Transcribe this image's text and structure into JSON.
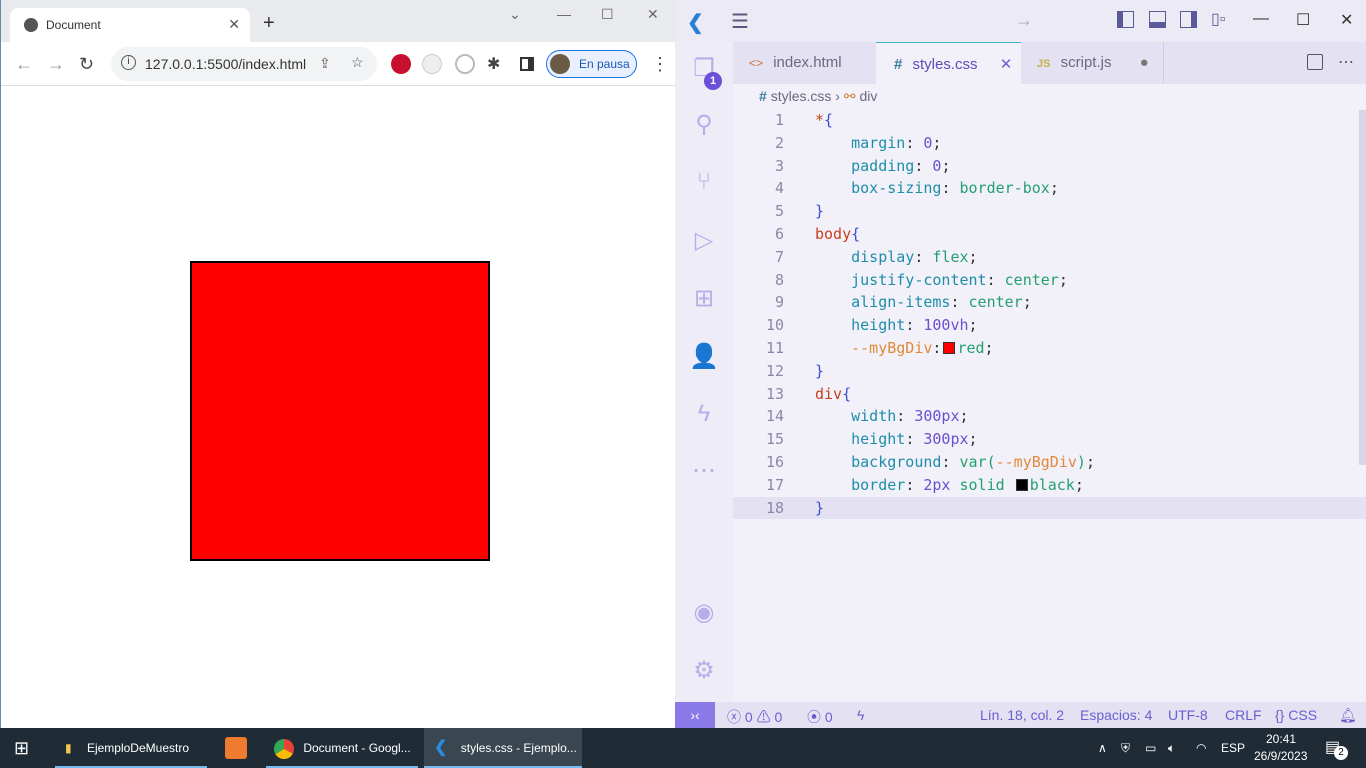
{
  "browser": {
    "tab_title": "Document",
    "url": "127.0.0.1:5500/index.html",
    "profile_label": "En pausa",
    "box_color": "#ff0000"
  },
  "vscode": {
    "tabs": [
      {
        "label": "index.html",
        "icon": "<>"
      },
      {
        "label": "styles.css",
        "icon": "#"
      },
      {
        "label": "script.js",
        "icon": "JS"
      }
    ],
    "explorer_badge": "1",
    "breadcrumb": {
      "file": "styles.css",
      "symbol": "div"
    },
    "lines": [
      [
        [
          "sel",
          "*"
        ],
        [
          "br",
          "{"
        ]
      ],
      [
        [
          "pn",
          "    "
        ],
        [
          "prop",
          "margin"
        ],
        [
          "pn",
          ": "
        ],
        [
          "numv",
          "0"
        ],
        [
          "pn",
          ";"
        ]
      ],
      [
        [
          "pn",
          "    "
        ],
        [
          "prop",
          "padding"
        ],
        [
          "pn",
          ": "
        ],
        [
          "numv",
          "0"
        ],
        [
          "pn",
          ";"
        ]
      ],
      [
        [
          "pn",
          "    "
        ],
        [
          "prop",
          "box-sizing"
        ],
        [
          "pn",
          ": "
        ],
        [
          "val",
          "border-box"
        ],
        [
          "pn",
          ";"
        ]
      ],
      [
        [
          "br",
          "}"
        ]
      ],
      [
        [
          "sel",
          "body"
        ],
        [
          "br",
          "{"
        ]
      ],
      [
        [
          "pn",
          "    "
        ],
        [
          "prop",
          "display"
        ],
        [
          "pn",
          ": "
        ],
        [
          "val",
          "flex"
        ],
        [
          "pn",
          ";"
        ]
      ],
      [
        [
          "pn",
          "    "
        ],
        [
          "prop",
          "justify-content"
        ],
        [
          "pn",
          ": "
        ],
        [
          "val",
          "center"
        ],
        [
          "pn",
          ";"
        ]
      ],
      [
        [
          "pn",
          "    "
        ],
        [
          "prop",
          "align-items"
        ],
        [
          "pn",
          ": "
        ],
        [
          "val",
          "center"
        ],
        [
          "pn",
          ";"
        ]
      ],
      [
        [
          "pn",
          "    "
        ],
        [
          "prop",
          "height"
        ],
        [
          "pn",
          ": "
        ],
        [
          "numv",
          "100vh"
        ],
        [
          "pn",
          ";"
        ]
      ],
      [
        [
          "pn",
          "    "
        ],
        [
          "var",
          "--myBgDiv"
        ],
        [
          "pn",
          ":"
        ],
        [
          "swatch",
          "#ff0000"
        ],
        [
          "val",
          "red"
        ],
        [
          "pn",
          ";"
        ]
      ],
      [
        [
          "br",
          "}"
        ]
      ],
      [
        [
          "sel",
          "div"
        ],
        [
          "br",
          "{"
        ]
      ],
      [
        [
          "pn",
          "    "
        ],
        [
          "prop",
          "width"
        ],
        [
          "pn",
          ": "
        ],
        [
          "numv",
          "300px"
        ],
        [
          "pn",
          ";"
        ]
      ],
      [
        [
          "pn",
          "    "
        ],
        [
          "prop",
          "height"
        ],
        [
          "pn",
          ": "
        ],
        [
          "numv",
          "300px"
        ],
        [
          "pn",
          ";"
        ]
      ],
      [
        [
          "pn",
          "    "
        ],
        [
          "prop",
          "background"
        ],
        [
          "pn",
          ": "
        ],
        [
          "val",
          "var("
        ],
        [
          "var",
          "--myBgDiv"
        ],
        [
          "val",
          ")"
        ],
        [
          "pn",
          ";"
        ]
      ],
      [
        [
          "pn",
          "    "
        ],
        [
          "prop",
          "border"
        ],
        [
          "pn",
          ": "
        ],
        [
          "numv",
          "2px"
        ],
        [
          "pn",
          " "
        ],
        [
          "val",
          "solid "
        ],
        [
          "swatch",
          "#000000"
        ],
        [
          "val",
          "black"
        ],
        [
          "pn",
          ";"
        ]
      ],
      [
        [
          "br",
          "}"
        ]
      ]
    ],
    "status": {
      "errors": "0",
      "warnings": "0",
      "ports": "0",
      "position": "Lín. 18, col. 2",
      "spaces": "Espacios: 4",
      "encoding": "UTF-8",
      "eol": "CRLF",
      "language": "CSS"
    }
  },
  "taskbar": {
    "items": [
      "EjemploDeMuestro",
      "Document - Googl...",
      "styles.css - Ejemplo..."
    ],
    "lang": "ESP",
    "time": "20:41",
    "date": "26/9/2023",
    "notifications": "2"
  }
}
